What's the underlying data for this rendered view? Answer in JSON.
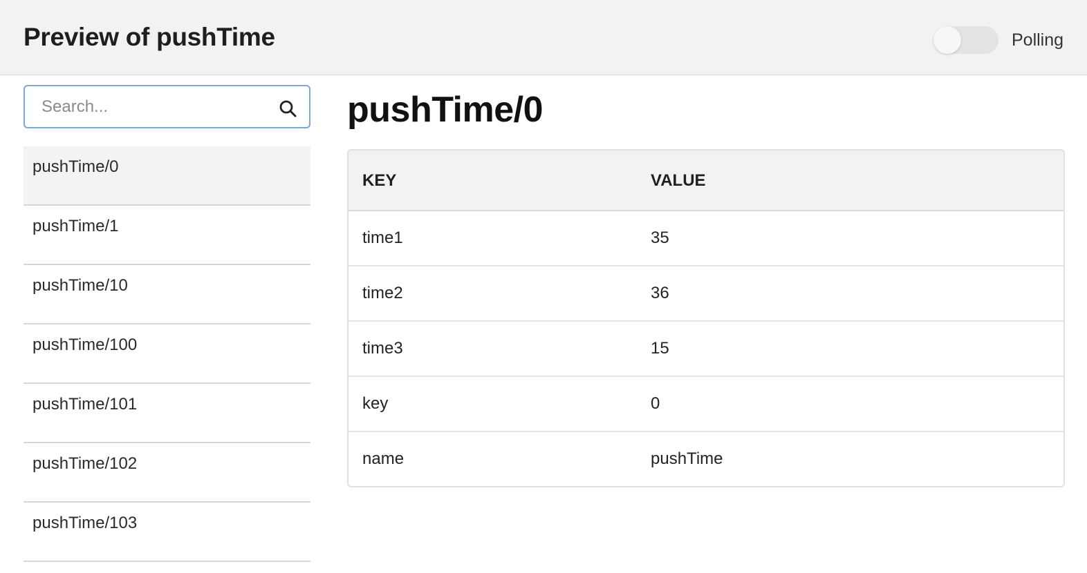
{
  "header": {
    "title": "Preview of pushTime",
    "polling_label": "Polling",
    "polling_enabled": false
  },
  "search": {
    "placeholder": "Search...",
    "value": ""
  },
  "sidebar": {
    "selected_index": 0,
    "items": [
      {
        "label": "pushTime/0"
      },
      {
        "label": "pushTime/1"
      },
      {
        "label": "pushTime/10"
      },
      {
        "label": "pushTime/100"
      },
      {
        "label": "pushTime/101"
      },
      {
        "label": "pushTime/102"
      },
      {
        "label": "pushTime/103"
      }
    ]
  },
  "detail": {
    "title": "pushTime/0",
    "columns": {
      "key": "KEY",
      "value": "VALUE"
    },
    "rows": [
      {
        "key": "time1",
        "value": "35"
      },
      {
        "key": "time2",
        "value": "36"
      },
      {
        "key": "time3",
        "value": "15"
      },
      {
        "key": "key",
        "value": "0"
      },
      {
        "key": "name",
        "value": "pushTime"
      }
    ]
  },
  "icons": {
    "search": "search-icon"
  },
  "colors": {
    "header_bg": "#f2f2f2",
    "search_border": "#7da7d9",
    "selected_row_bg": "#f3f3f3",
    "toggle_track": "#e3e3e3"
  }
}
